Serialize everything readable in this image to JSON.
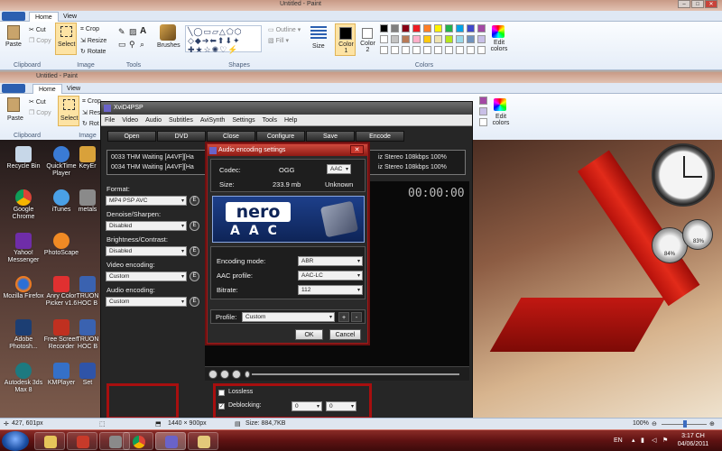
{
  "paint_back": {
    "title": "Untitled - Paint",
    "tabs": [
      "Home",
      "View"
    ],
    "clipboard": {
      "paste": "Paste",
      "cut": "Cut",
      "copy": "Copy",
      "label": "Clipboard"
    },
    "image": {
      "select": "Select",
      "crop": "Crop",
      "resize": "Resize",
      "rotate": "Rotate",
      "label": "Image"
    },
    "tools_label": "Tools",
    "brushes": "Brushes",
    "shapes": {
      "outline": "Outline",
      "fill": "Fill",
      "label": "Shapes"
    },
    "size": "Size",
    "color1": "Color 1",
    "color2": "Color 2",
    "edit_colors": "Edit colors",
    "colors_label": "Colors"
  },
  "paint_front": {
    "title": "Untitled - Paint",
    "tabs": [
      "Home",
      "View"
    ],
    "clipboard": {
      "paste": "Paste",
      "cut": "Cut",
      "copy": "Copy",
      "label": "Clipboard"
    },
    "image": {
      "select": "Select",
      "crop": "Crop",
      "resize": "Resi",
      "rotate": "Rot",
      "label": "Image"
    },
    "edit_colors": "Edit colors"
  },
  "palette": [
    "#000000",
    "#7f7f7f",
    "#880015",
    "#ed1c24",
    "#ff7f27",
    "#fff200",
    "#22b14c",
    "#00a2e8",
    "#3f48cc",
    "#a349a4",
    "#ffffff",
    "#c3c3c3",
    "#b97a57",
    "#ffaec9",
    "#ffc90e",
    "#efe4b0",
    "#b5e61d",
    "#99d9ea",
    "#7092be",
    "#c8bfe7"
  ],
  "desktop_icons": [
    {
      "label": "Recycle Bin"
    },
    {
      "label": "QuickTime Player"
    },
    {
      "label": "KeyEr"
    },
    {
      "label": "Google Chrome"
    },
    {
      "label": "iTunes"
    },
    {
      "label": "metals"
    },
    {
      "label": "Yahoo! Messenger"
    },
    {
      "label": "PhotoScape"
    },
    {
      "label": "Mozilla Firefox"
    },
    {
      "label": "Anry Color Picker v1.6"
    },
    {
      "label": "TRUON HOC B"
    },
    {
      "label": "Adobe Photosh..."
    },
    {
      "label": "Free Screen Recorder"
    },
    {
      "label": "TRUON HOC B"
    },
    {
      "label": "Autodesk 3ds Max 8"
    },
    {
      "label": "KMPlayer"
    },
    {
      "label": "Set"
    }
  ],
  "xvid": {
    "title": "XviD4PSP",
    "menu": [
      "File",
      "Video",
      "Audio",
      "Subtitles",
      "AviSynth",
      "Settings",
      "Tools",
      "Help"
    ],
    "buttons": [
      "Open",
      "DVD",
      "Close",
      "Configure",
      "Save",
      "Encode"
    ],
    "tasks": [
      {
        "left": "0033   THM   Waiting   [A4VF][Ha",
        "right": "iz  Stereo  108kbps  100%"
      },
      {
        "left": "0034   THM   Waiting   [A4VF][Ha",
        "right": "iz  Stereo  108kbps  100%"
      }
    ],
    "format_label": "Format:",
    "format_value": "MP4 PSP AVC",
    "denoise_label": "Denoise/Sharpen:",
    "denoise_value": "Disabled",
    "brightness_label": "Brightness/Contrast:",
    "brightness_value": "Disabled",
    "video_enc_label": "Video encoding:",
    "video_enc_value": "Custom",
    "audio_enc_label": "Audio encoding:",
    "audio_enc_value": "Custom",
    "e": "E",
    "timecode": "00:00:00",
    "lossless": "Lossless",
    "deblocking": "Deblocking:",
    "deblock_a": "0",
    "deblock_b": "0"
  },
  "dialog": {
    "title": "Audio encoding settings",
    "close": "✕",
    "codec_label": "Codec:",
    "codec_value": "OGG",
    "codec_select": "AAC",
    "size_label": "Size:",
    "size_value": "233.9 mb",
    "size_unknown": "Unknown",
    "logo_top": "nero",
    "logo_bottom": "AAC",
    "mode_label": "Encoding mode:",
    "mode_value": "ABR",
    "profile_label": "AAC profile:",
    "profile_value": "AAC-LC",
    "bitrate_label": "Bitrate:",
    "bitrate_value": "112",
    "preset_label": "Profile:",
    "preset_value": "Custom",
    "plus": "+",
    "minus": "-",
    "ok": "OK",
    "cancel": "Cancel"
  },
  "status": {
    "cursor": "427, 601px",
    "dims": "1440 × 900px",
    "size": "Size: 884,7KB",
    "zoom": "100%"
  },
  "taskbar": {
    "lang": "EN",
    "time": "3:17 CH",
    "date": "04/06/2011"
  },
  "gadgets": {
    "g1": "84%",
    "g2": "83%"
  }
}
